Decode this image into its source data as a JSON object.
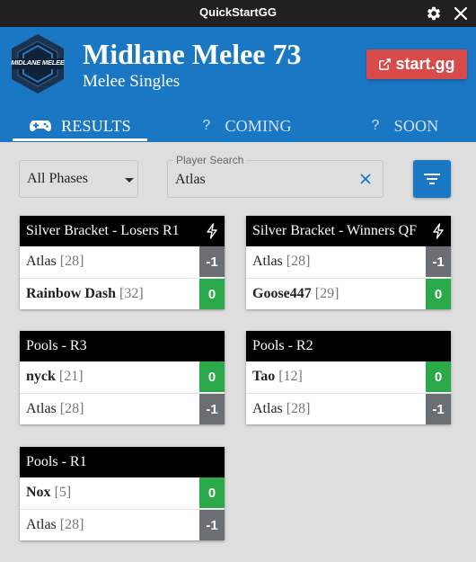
{
  "window": {
    "title": "QuickStartGG"
  },
  "header": {
    "logo_text": "MIDLANE MELEE",
    "event_title": "Midlane Melee 73",
    "event_subtitle": "Melee Singles",
    "startgg_label": "start.gg"
  },
  "tabs": [
    {
      "icon": "gamepad-icon",
      "label": "RESULTS",
      "active": true
    },
    {
      "icon": "?",
      "label": "COMING",
      "active": false
    },
    {
      "icon": "?",
      "label": "SOON",
      "active": false
    }
  ],
  "filters": {
    "phase_value": "All Phases",
    "search_label": "Player Search",
    "search_value": "Atlas"
  },
  "sets": [
    {
      "title": "Silver Bracket - Losers R1",
      "icon": "bolt-icon",
      "entrants": [
        {
          "name": "Atlas",
          "seed": "[28]",
          "score": "-1",
          "winner": false
        },
        {
          "name": "Rainbow Dash",
          "seed": "[32]",
          "score": "0",
          "winner": true
        }
      ]
    },
    {
      "title": "Silver Bracket - Winners QF",
      "icon": "bolt-icon",
      "entrants": [
        {
          "name": "Atlas",
          "seed": "[28]",
          "score": "-1",
          "winner": false
        },
        {
          "name": "Goose447",
          "seed": "[29]",
          "score": "0",
          "winner": true
        }
      ]
    },
    {
      "title": "Pools - R3",
      "entrants": [
        {
          "name": "nyck",
          "seed": "[21]",
          "score": "0",
          "winner": true
        },
        {
          "name": "Atlas",
          "seed": "[28]",
          "score": "-1",
          "winner": false
        }
      ]
    },
    {
      "title": "Pools - R2",
      "entrants": [
        {
          "name": "Tao",
          "seed": "[12]",
          "score": "0",
          "winner": true
        },
        {
          "name": "Atlas",
          "seed": "[28]",
          "score": "-1",
          "winner": false
        }
      ]
    },
    {
      "title": "Pools - R1",
      "entrants": [
        {
          "name": "Nox",
          "seed": "[5]",
          "score": "0",
          "winner": true
        },
        {
          "name": "Atlas",
          "seed": "[28]",
          "score": "-1",
          "winner": false
        }
      ]
    }
  ],
  "colors": {
    "brand_blue": "#1a77c4",
    "startgg_red": "#d94b4b",
    "win_green": "#2aa84a",
    "loss_gray": "#6b6e72"
  }
}
